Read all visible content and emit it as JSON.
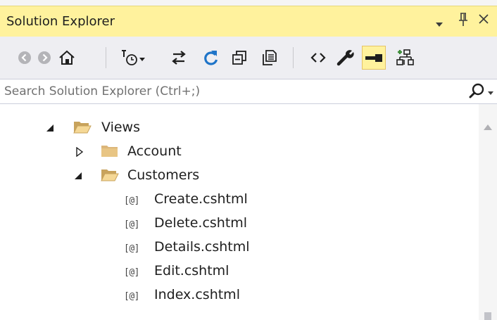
{
  "panel": {
    "title": "Solution Explorer",
    "dropdown_icon": "dropdown-icon",
    "pin_icon": "pin-icon",
    "close_icon": "close-icon"
  },
  "toolbar": {
    "buttons": [
      {
        "name": "back",
        "icon": "back-arrow-icon"
      },
      {
        "name": "forward",
        "icon": "forward-arrow-icon"
      },
      {
        "name": "home",
        "icon": "home-icon"
      },
      {
        "name": "pending-changes-filter",
        "icon": "pending-changes-filter-icon"
      },
      {
        "name": "sync-with-active-document",
        "icon": "sync-icon"
      },
      {
        "name": "refresh",
        "icon": "refresh-icon"
      },
      {
        "name": "collapse-all",
        "icon": "collapse-all-icon"
      },
      {
        "name": "show-all-files",
        "icon": "show-all-files-icon"
      },
      {
        "name": "view-code",
        "icon": "code-icon"
      },
      {
        "name": "properties",
        "icon": "wrench-icon"
      },
      {
        "name": "preview-selected-items",
        "icon": "preview-icon",
        "active": true
      },
      {
        "name": "class-view",
        "icon": "class-diagram-icon"
      }
    ],
    "accent_color": "#fff29d"
  },
  "search": {
    "placeholder": "Search Solution Explorer (Ctrl+;)",
    "value": ""
  },
  "tree": {
    "items": [
      {
        "label": "Views",
        "type": "folder",
        "expanded": true,
        "depth": 0
      },
      {
        "label": "Account",
        "type": "folder",
        "expanded": false,
        "depth": 1
      },
      {
        "label": "Customers",
        "type": "folder",
        "expanded": true,
        "depth": 1
      },
      {
        "label": "Create.cshtml",
        "type": "razor-file",
        "badge": "[@]",
        "depth": 2
      },
      {
        "label": "Delete.cshtml",
        "type": "razor-file",
        "badge": "[@]",
        "depth": 2
      },
      {
        "label": "Details.cshtml",
        "type": "razor-file",
        "badge": "[@]",
        "depth": 2
      },
      {
        "label": "Edit.cshtml",
        "type": "razor-file",
        "badge": "[@]",
        "depth": 2
      },
      {
        "label": "Index.cshtml",
        "type": "razor-file",
        "badge": "[@]",
        "depth": 2
      }
    ]
  },
  "colors": {
    "title_bar": "#fff29d",
    "refresh_blue": "#1e74c8",
    "folder": "#dcb67a"
  }
}
